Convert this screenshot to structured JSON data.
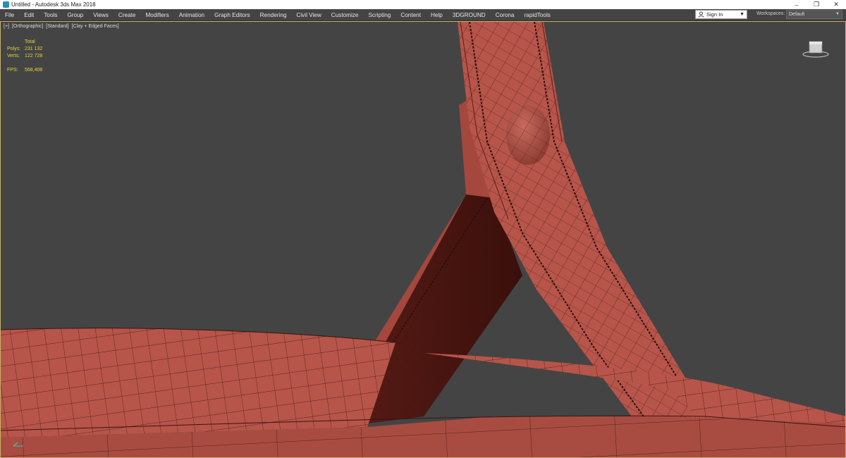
{
  "window": {
    "title": "Untitled - Autodesk 3ds Max 2018",
    "controls": {
      "minimize": "–",
      "restore": "❐",
      "close": "✕"
    }
  },
  "menubar": {
    "items": [
      {
        "label": "File"
      },
      {
        "label": "Edit"
      },
      {
        "label": "Tools"
      },
      {
        "label": "Group"
      },
      {
        "label": "Views"
      },
      {
        "label": "Create"
      },
      {
        "label": "Modifiers"
      },
      {
        "label": "Animation"
      },
      {
        "label": "Graph Editors"
      },
      {
        "label": "Rendering"
      },
      {
        "label": "Civil View"
      },
      {
        "label": "Customize"
      },
      {
        "label": "Scripting"
      },
      {
        "label": "Content"
      },
      {
        "label": "Help"
      },
      {
        "label": "3DGROUND"
      },
      {
        "label": "Corona"
      },
      {
        "label": "rapidTools"
      }
    ],
    "signin": {
      "label": "Sign In",
      "icon": "user-icon"
    },
    "workspaces": {
      "label": "Workspaces:",
      "value": "Default"
    }
  },
  "viewport": {
    "labels": [
      "[+]",
      "[Orthographic]",
      "[Standard]",
      "[Clay + Edged Faces]"
    ],
    "stats": {
      "header": "Total",
      "polys_label": "Polys:",
      "polys_value": "231 132",
      "verts_label": "Verts:",
      "verts_value": "122 728",
      "fps_label": "FPS:",
      "fps_value": "568,408"
    },
    "colors": {
      "clay": "#b7554a",
      "clay_dark": "#7a2b25",
      "wire": "#3a1410",
      "background": "#444444",
      "stats_text": "#e8d23e",
      "border": "#c9b36a"
    }
  }
}
